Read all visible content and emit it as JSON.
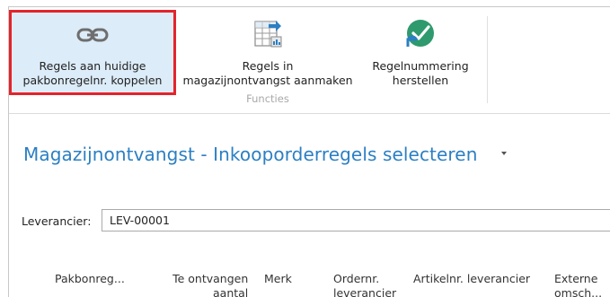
{
  "ribbon": {
    "buttons": [
      {
        "line1": "Regels aan huidige",
        "line2": "pakbonregelnr. koppelen",
        "icon": "link-icon"
      },
      {
        "line1": "Regels in",
        "line2": "magazijnontvangst aanmaken",
        "icon": "spreadsheet-arrow-icon"
      },
      {
        "line1": "Regelnummering",
        "line2": "herstellen",
        "icon": "checkmark-circle-icon"
      }
    ],
    "group_label": "Functies"
  },
  "page": {
    "title": "Magazijnontvangst - Inkooporderregels selecteren"
  },
  "vendor": {
    "label": "Leverancier:",
    "value": "LEV-00001"
  },
  "grid": {
    "columns": [
      {
        "line1": "Pakbonreg...",
        "line2": ""
      },
      {
        "line1": "Te ontvangen",
        "line2": "aantal"
      },
      {
        "line1": "Merk",
        "line2": ""
      },
      {
        "line1": "Ordernr.",
        "line2": "leverancier"
      },
      {
        "line1": "Artikelnr. leverancier",
        "line2": ""
      },
      {
        "line1": "Externe",
        "line2": "omsch..."
      }
    ]
  },
  "colors": {
    "accent": "#2b7fc3",
    "selected_bg": "#dcecf8",
    "highlight_border": "#e5232b",
    "check_green": "#2e9a6d"
  }
}
